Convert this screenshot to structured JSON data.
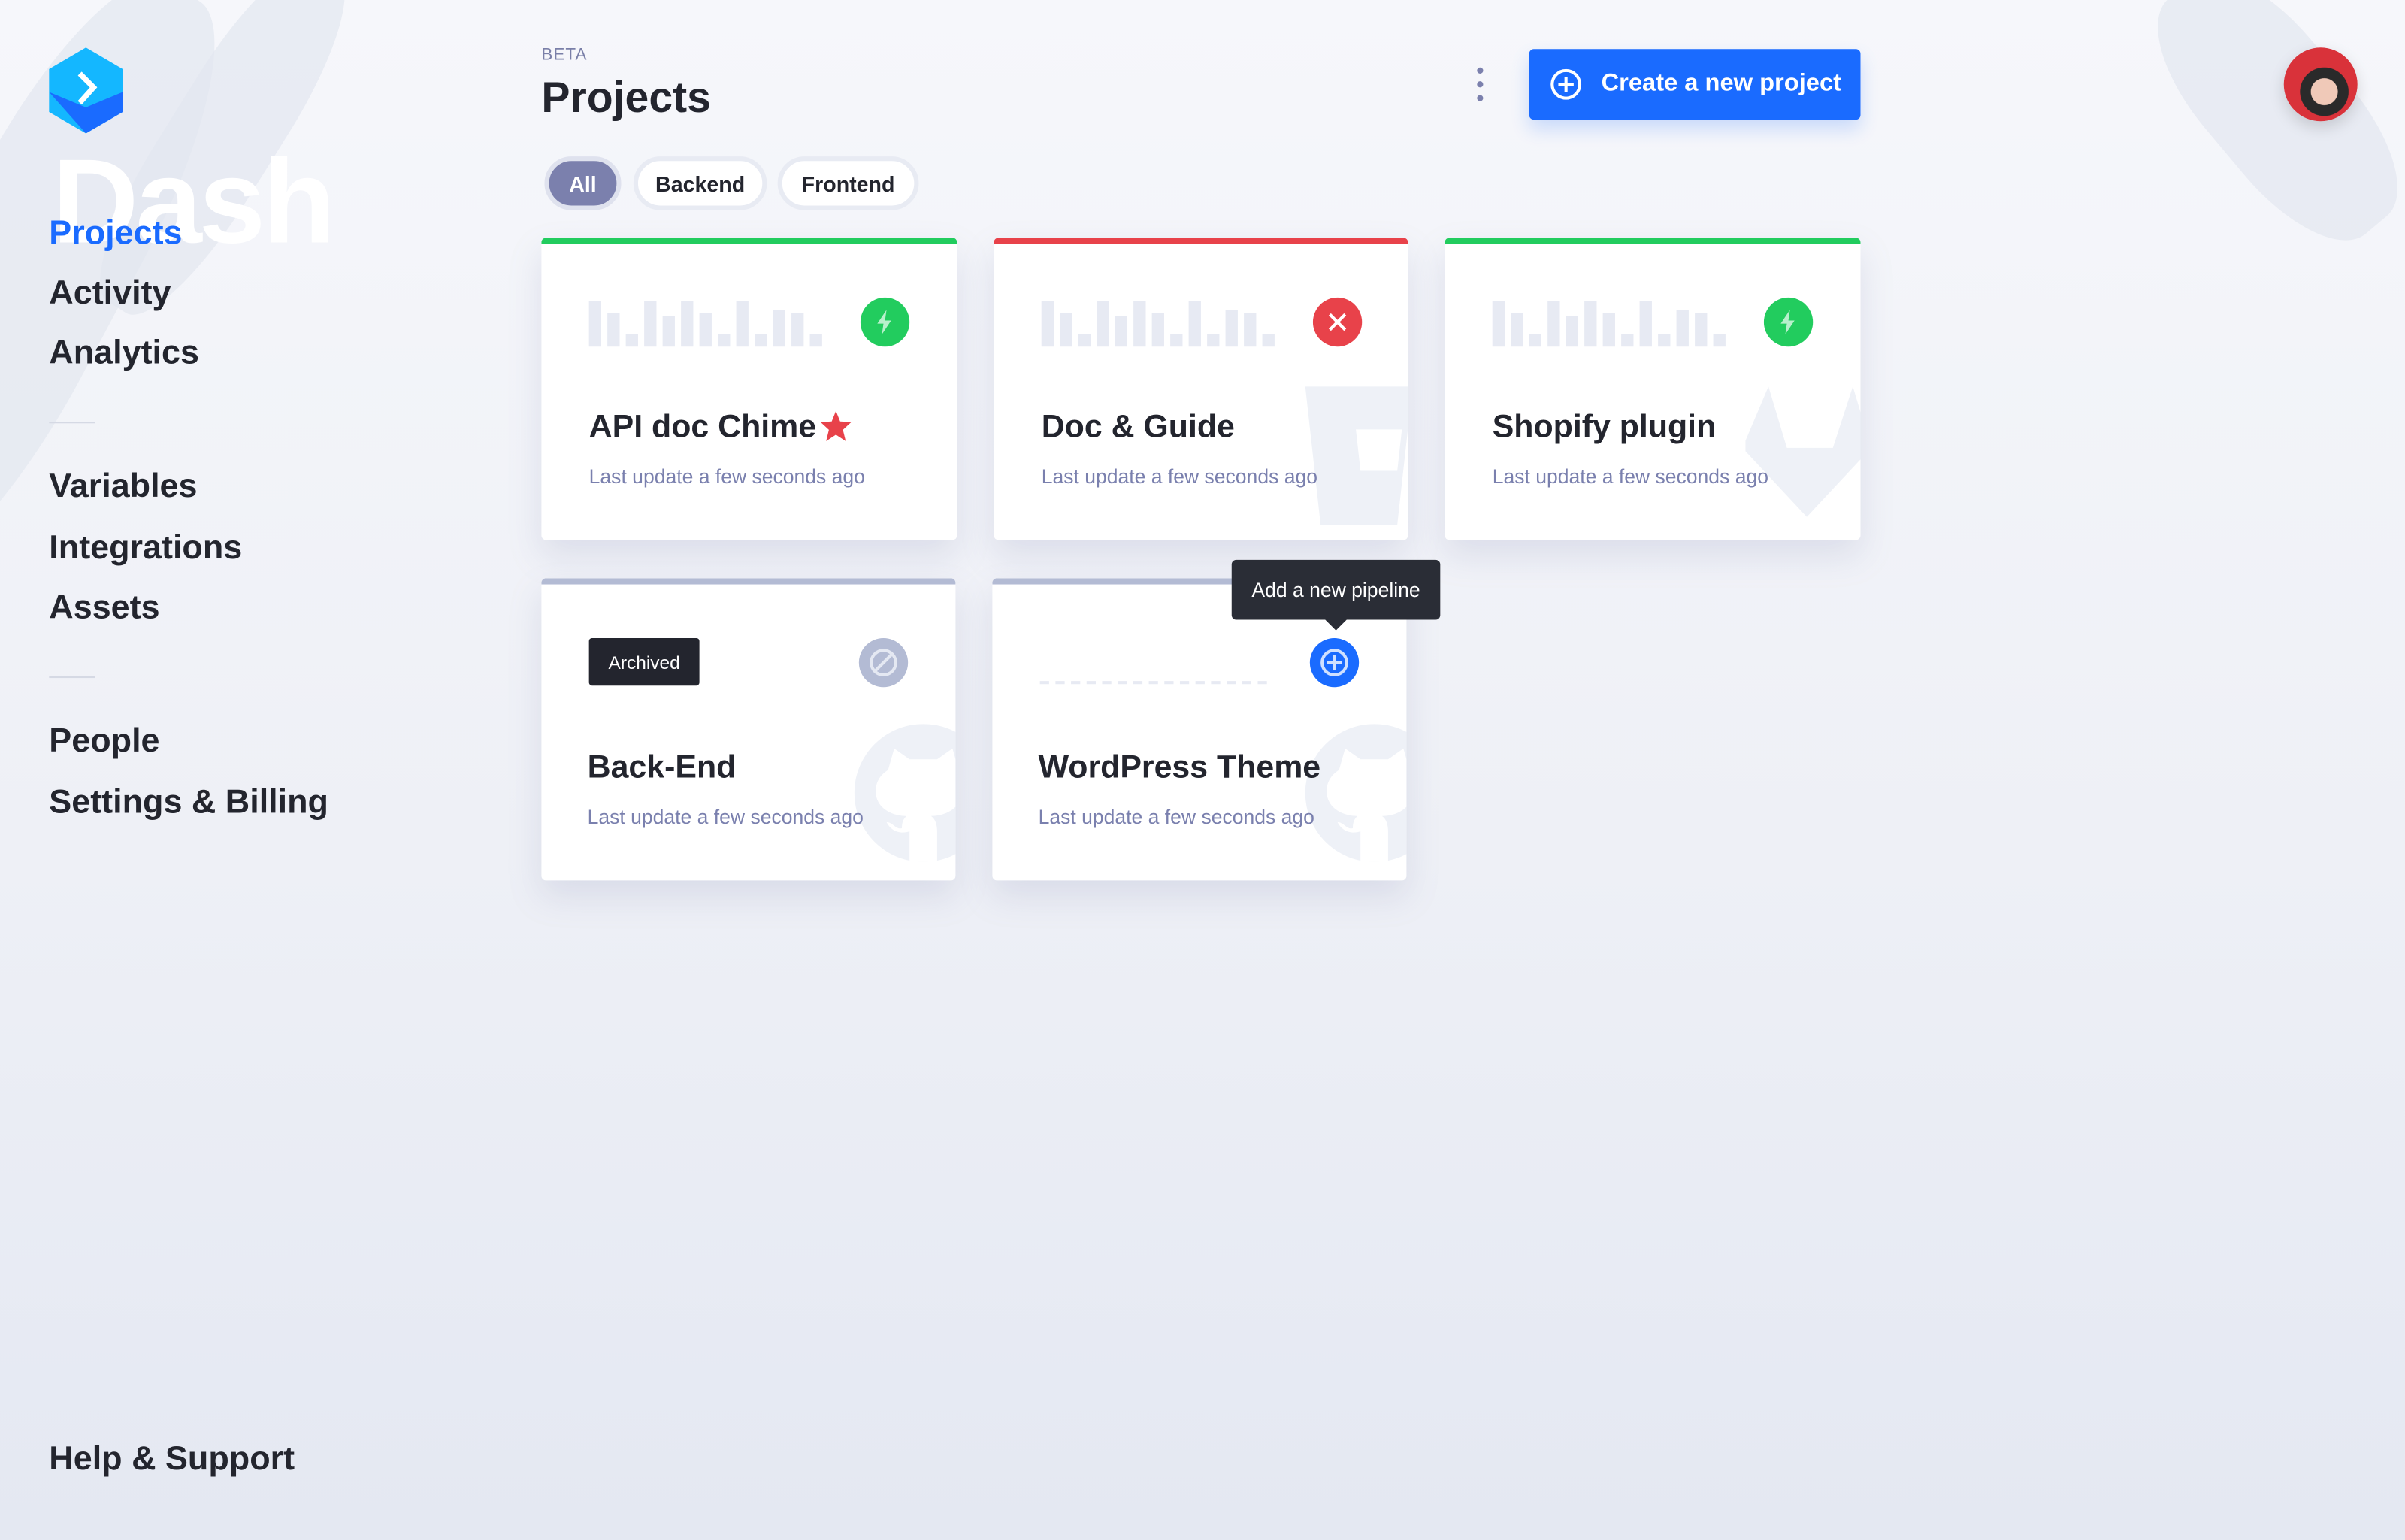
{
  "brand": {
    "name": "Dash"
  },
  "sidebar": {
    "primary": [
      {
        "label": "Projects",
        "active": true
      },
      {
        "label": "Activity"
      },
      {
        "label": "Analytics"
      }
    ],
    "secondary": [
      {
        "label": "Variables"
      },
      {
        "label": "Integrations"
      },
      {
        "label": "Assets"
      }
    ],
    "tertiary": [
      {
        "label": "People"
      },
      {
        "label": "Settings & Billing"
      }
    ],
    "footer": {
      "label": "Help & Support"
    }
  },
  "header": {
    "badge": "BETA",
    "title": "Projects",
    "filters": [
      {
        "label": "All",
        "active": true
      },
      {
        "label": "Backend"
      },
      {
        "label": "Frontend"
      }
    ],
    "create_label": "Create a new project",
    "more_icon": "kebab-vertical-icon"
  },
  "colors": {
    "accent": "#1a6bff",
    "success": "#22cc5e",
    "error": "#e8424a",
    "archived": "#b3bbd4"
  },
  "projects": [
    {
      "title": "API doc Chime",
      "updated": "Last update a few seconds ago",
      "status": "success",
      "starred": true,
      "bg_icon": "none"
    },
    {
      "title": "Doc & Guide",
      "updated": "Last update a few seconds ago",
      "status": "failed",
      "bg_icon": "bitbucket-icon"
    },
    {
      "title": "Shopify plugin",
      "updated": "Last update a few seconds ago",
      "status": "success",
      "bg_icon": "gitlab-icon"
    },
    {
      "title": "Back-End",
      "updated": "Last update a few seconds ago",
      "status": "archived",
      "badge": "Archived",
      "bg_icon": "github-icon"
    },
    {
      "title": "WordPress Theme",
      "updated": "Last update a few seconds ago",
      "status": "no-pipeline",
      "bg_icon": "github-icon"
    }
  ],
  "tooltip": {
    "text": "Add a new pipeline"
  }
}
